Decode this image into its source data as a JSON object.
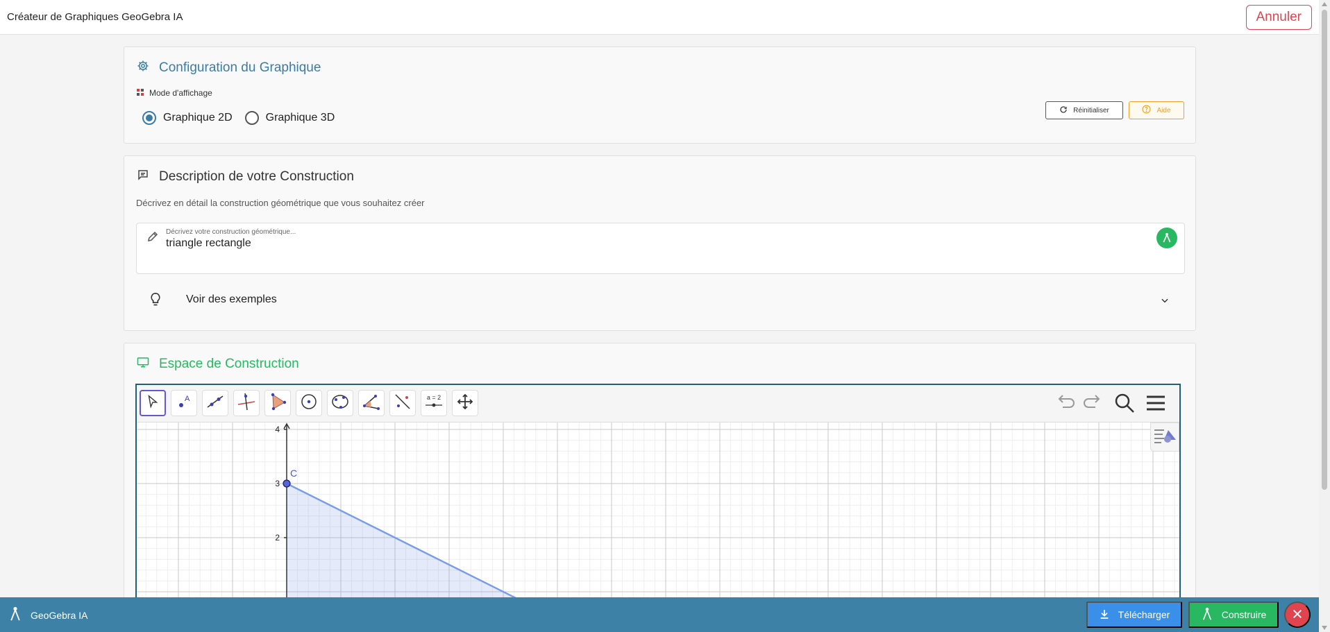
{
  "app": {
    "title": "Créateur de Graphiques GeoGebra IA",
    "cancel_label": "Annuler"
  },
  "config": {
    "title": "Configuration du Graphique",
    "mode_label": "Mode d'affichage",
    "options": [
      "Graphique 2D",
      "Graphique 3D"
    ],
    "selected": "Graphique 2D",
    "reset_label": "Réinitialiser",
    "help_label": "Aide",
    "accent": "#3a7ca5"
  },
  "description": {
    "title": "Description de votre Construction",
    "subtitle": "Décrivez en détail la construction géométrique que vous souhaitez créer",
    "input_placeholder": "Décrivez votre construction géométrique...",
    "input_value": "triangle rectangle",
    "examples_label": "Voir des exemples"
  },
  "construction": {
    "title": "Espace de Construction",
    "accent": "#27b861",
    "toolbar_tools": [
      "move-tool",
      "point-tool",
      "line-tool",
      "perpendicular-tool",
      "polygon-tool",
      "circle-tool",
      "conic-tool",
      "angle-tool",
      "reflect-tool",
      "slider-tool",
      "move-view-tool"
    ],
    "slider_tool_text": "a = 2",
    "axis_ticks_y": [
      "4",
      "3",
      "2"
    ],
    "point_label": "C"
  },
  "footer": {
    "brand": "GeoGebra IA",
    "download_label": "Télécharger",
    "build_label": "Construire",
    "colors": {
      "bar": "#3d82a6",
      "download": "#3a8fe8",
      "build": "#27b861",
      "close": "#e0454f"
    }
  }
}
